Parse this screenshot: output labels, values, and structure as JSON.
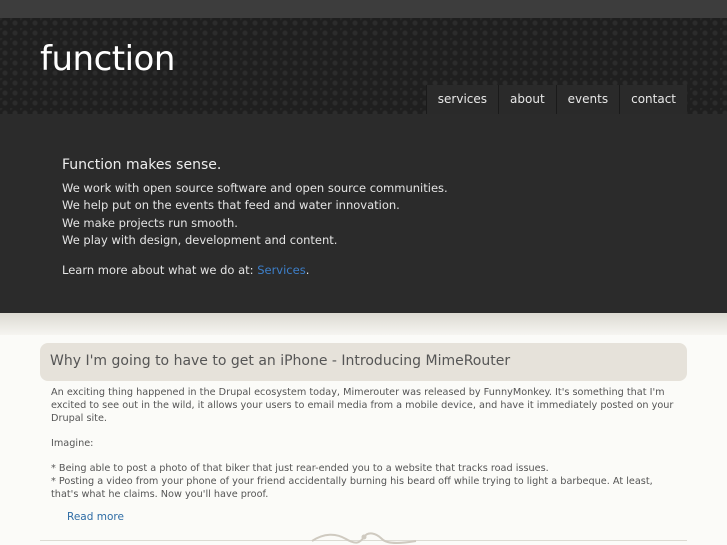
{
  "header": {
    "logo": "function",
    "nav": [
      "services",
      "about",
      "events",
      "contact"
    ]
  },
  "intro": {
    "title": "Function makes sense.",
    "lines": [
      "We work with open source software and open source communities.",
      "We help put on the events that feed and water innovation.",
      "We make projects run smooth.",
      "We play with design, development and content."
    ],
    "learn_prefix": "Learn more about what we do at: ",
    "learn_link": "Services",
    "learn_suffix": "."
  },
  "post": {
    "title": "Why I'm going to have to get an iPhone - Introducing MimeRouter",
    "p1": "An exciting thing happened in the Drupal ecosystem today, Mimerouter was released by FunnyMonkey. It's something that I'm excited to see out in the wild, it allows your users to email media from a mobile device, and have it immediately posted on your Drupal site.",
    "p2": "Imagine:",
    "bullet1": "* Being able to post a photo of that biker that just rear-ended you to a website that tracks road issues.",
    "bullet2": "* Posting a video from your phone of your friend accidentally burning his beard off while trying to light a barbeque. At least, that's what he claims. Now you'll have proof.",
    "read_more": "Read more"
  },
  "colors": {
    "link": "#3d7fc9",
    "header_bg": "#1f1f1f",
    "intro_bg": "#2b2b2b",
    "title_bar_bg": "#e6e2da"
  }
}
